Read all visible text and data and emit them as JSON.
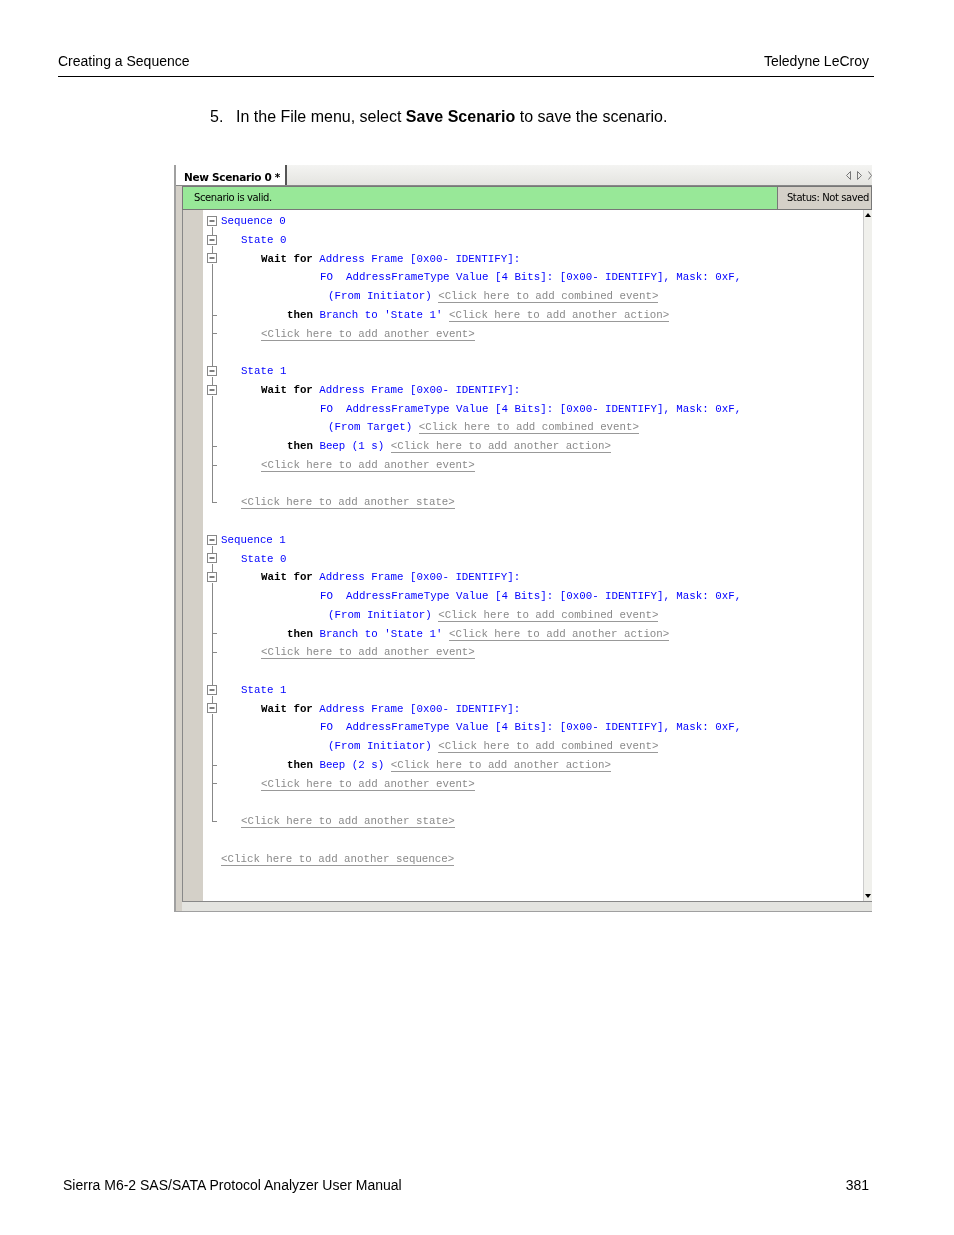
{
  "header": {
    "section": "Creating a Sequence",
    "company": "Teledyne LeCroy"
  },
  "step": {
    "number": "5.",
    "text": "In the File menu, select **Save Scenario** to save the scenario."
  },
  "window": {
    "tab": {
      "label": "New Scenario 0 *",
      "selected": true
    },
    "validation": "Scenario is valid.",
    "status": "Status: Not saved",
    "sequences": [
      {
        "label": "Sequence 0",
        "expanded": true,
        "states": [
          {
            "label": "State 0",
            "expanded": true,
            "events": [
              {
                "expanded": true,
                "wait": "Wait for",
                "frame": "Address Frame [0x00- IDENTIFY]:",
                "field": "FO  AddressFrameType Value [4 Bits]: [0x00- IDENTIFY], Mask: 0xF,",
                "source": "(From Initiator)",
                "add_combined": "<Click here to add combined event>",
                "then": "then",
                "action": "Branch to 'State 1'",
                "add_action": "<Click here to add another action>"
              }
            ],
            "add_event": "<Click here to add another event>"
          },
          {
            "label": "State 1",
            "expanded": true,
            "events": [
              {
                "expanded": true,
                "wait": "Wait for",
                "frame": "Address Frame [0x00- IDENTIFY]:",
                "field": "FO  AddressFrameType Value [4 Bits]: [0x00- IDENTIFY], Mask: 0xF,",
                "source": "(From Target)",
                "add_combined": "<Click here to add combined event>",
                "then": "then",
                "action": "Beep (1 s)",
                "add_action": "<Click here to add another action>"
              }
            ],
            "add_event": "<Click here to add another event>"
          }
        ],
        "add_state": "<Click here to add another state>"
      },
      {
        "label": "Sequence 1",
        "expanded": true,
        "states": [
          {
            "label": "State 0",
            "expanded": true,
            "events": [
              {
                "expanded": true,
                "wait": "Wait for",
                "frame": "Address Frame [0x00- IDENTIFY]:",
                "field": "FO  AddressFrameType Value [4 Bits]: [0x00- IDENTIFY], Mask: 0xF,",
                "source": "(From Initiator)",
                "add_combined": "<Click here to add combined event>",
                "then": "then",
                "action": "Branch to 'State 1'",
                "add_action": "<Click here to add another action>"
              }
            ],
            "add_event": "<Click here to add another event>"
          },
          {
            "label": "State 1",
            "expanded": true,
            "events": [
              {
                "expanded": true,
                "wait": "Wait for",
                "frame": "Address Frame [0x00- IDENTIFY]:",
                "field": "FO  AddressFrameType Value [4 Bits]: [0x00- IDENTIFY], Mask: 0xF,",
                "source": "(From Initiator)",
                "add_combined": "<Click here to add combined event>",
                "then": "then",
                "action": "Beep (2 s)",
                "add_action": "<Click here to add another action>"
              }
            ],
            "add_event": "<Click here to add another event>"
          }
        ],
        "add_state": "<Click here to add another state>"
      }
    ],
    "add_sequence": "<Click here to add another sequence>"
  },
  "footer": {
    "title": "Sierra M6-2 SAS/SATA Protocol Analyzer User Manual",
    "page": "381"
  }
}
